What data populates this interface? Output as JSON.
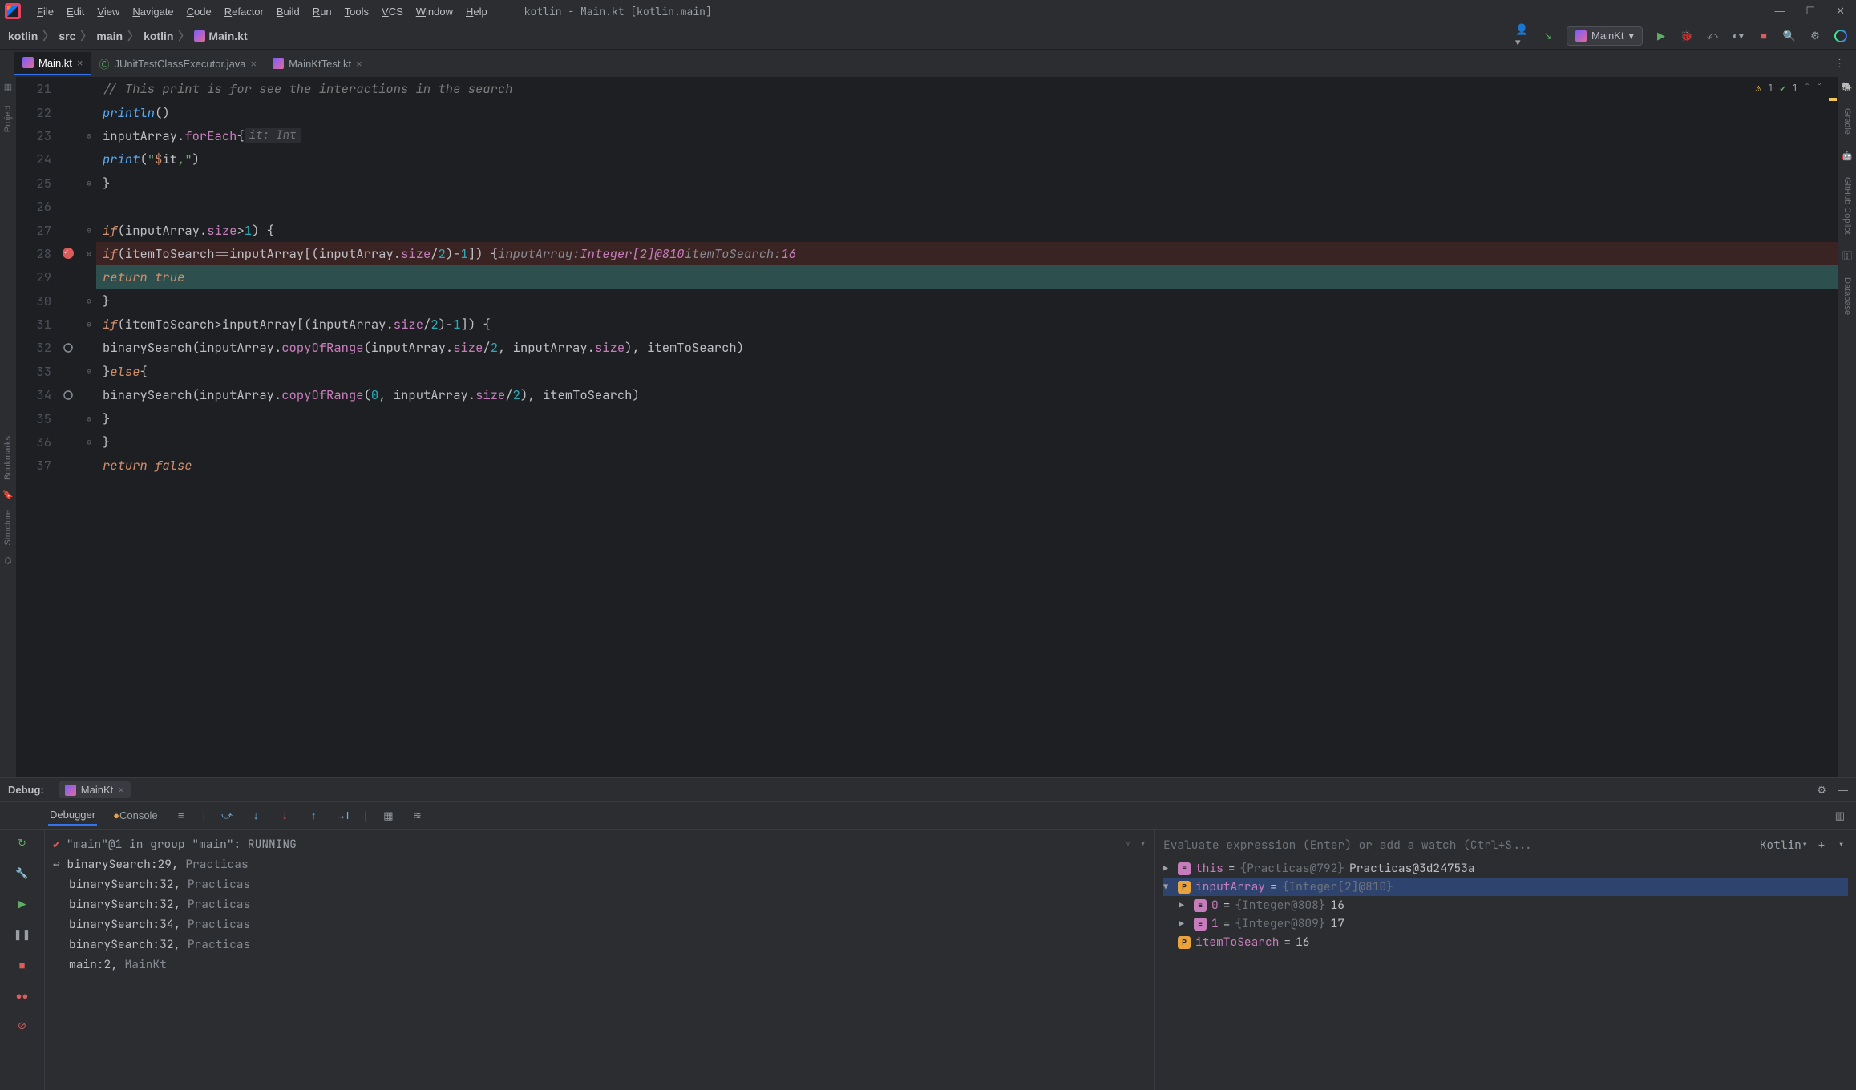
{
  "window": {
    "title": "kotlin - Main.kt [kotlin.main]"
  },
  "menu": [
    "File",
    "Edit",
    "View",
    "Navigate",
    "Code",
    "Refactor",
    "Build",
    "Run",
    "Tools",
    "VCS",
    "Window",
    "Help"
  ],
  "breadcrumb": [
    "kotlin",
    "src",
    "main",
    "kotlin",
    "Main.kt"
  ],
  "runConfig": "MainKt",
  "tabs": [
    {
      "label": "Main.kt",
      "active": true,
      "icon": "kotlin-file"
    },
    {
      "label": "JUnitTestClassExecutor.java",
      "active": false,
      "icon": "java-class"
    },
    {
      "label": "MainKtTest.kt",
      "active": false,
      "icon": "kotlin-class"
    }
  ],
  "inspections": {
    "warnings": "1",
    "passed": "1"
  },
  "editor": {
    "startLine": 21,
    "lines": [
      {
        "n": 21,
        "html": "        <span class='c-comment'>// This print is for see the interactions in the search</span>"
      },
      {
        "n": 22,
        "html": "        <span class='c-fn'>println</span><span class='c-brace'>()</span>"
      },
      {
        "n": 23,
        "html": "        <span class='c-id'>inputArray</span>.<span class='c-fn2'>forEach</span> <span class='c-brace'>{</span> <span class='c-hint'>it: Int</span>",
        "fold": "⊖"
      },
      {
        "n": 24,
        "html": "            <span class='c-fn'>print</span><span class='c-brace'>(</span><span class='c-str'>\"</span><span class='c-kw2'>$</span><span class='c-id'>it</span><span class='c-str'>,\"</span><span class='c-brace'>)</span>"
      },
      {
        "n": 25,
        "html": "        <span class='c-brace'>}</span>",
        "fold": "⊖"
      },
      {
        "n": 26,
        "html": ""
      },
      {
        "n": 27,
        "html": "        <span class='c-kw'>if</span> <span class='c-brace'>(</span><span class='c-id'>inputArray</span>.<span class='c-fn2'>size</span> <span class='c-op'>&gt;</span> <span class='c-num'>1</span><span class='c-brace'>) {</span>",
        "fold": "⊖"
      },
      {
        "n": 28,
        "bp": true,
        "hl": "bp",
        "html": "            <span class='c-kw'>if</span> <span class='c-brace'>(</span><span class='c-id'>itemToSearch</span> <span class='c-op'>==</span> <span class='c-id'>inputArray</span><span class='c-brace'>[(</span><span class='c-id'>inputArray</span>.<span class='c-fn2'>size</span> <span class='c-op'>/</span> <span class='c-num'>2</span><span class='c-brace'>)</span> <span class='c-op'>-</span> <span class='c-num'>1</span><span class='c-brace'>]) {</span>   <span class='c-inlay-var'>inputArray:</span> <span class='c-inlay-val'>Integer[2]@810</span>    <span class='c-inlay-var'>itemToSearch:</span> <span class='c-inlay-val'>16</span>",
        "fold": "⊖"
      },
      {
        "n": 29,
        "hl": "exec",
        "html": "                <span class='c-kw'>return true</span>"
      },
      {
        "n": 30,
        "html": "            <span class='c-brace'>}</span>",
        "fold": "⊖"
      },
      {
        "n": 31,
        "html": "            <span class='c-kw'>if</span> <span class='c-brace'>(</span><span class='c-id'>itemToSearch</span> <span class='c-op'>&gt;</span> <span class='c-id'>inputArray</span><span class='c-brace'>[(</span><span class='c-id'>inputArray</span>.<span class='c-fn2'>size</span> <span class='c-op'>/</span> <span class='c-num'>2</span><span class='c-brace'>)</span> <span class='c-op'>-</span> <span class='c-num'>1</span><span class='c-brace'>]) {</span>",
        "fold": "⊖"
      },
      {
        "n": 32,
        "cov": true,
        "html": "                <span class='c-id'>binarySearch</span><span class='c-brace'>(</span><span class='c-id'>inputArray</span>.<span class='c-fn2'>copyOfRange</span><span class='c-brace'>(</span><span class='c-id'>inputArray</span>.<span class='c-fn2'>size</span> <span class='c-op'>/</span> <span class='c-num'>2</span>, <span class='c-id'>inputArray</span>.<span class='c-fn2'>size</span><span class='c-brace'>)</span>, <span class='c-id'>itemToSearch</span><span class='c-brace'>)</span>"
      },
      {
        "n": 33,
        "html": "            <span class='c-brace'>}</span> <span class='c-kw'>else</span> <span class='c-brace'>{</span>",
        "fold": "⊖"
      },
      {
        "n": 34,
        "cov": true,
        "html": "                <span class='c-id'>binarySearch</span><span class='c-brace'>(</span><span class='c-id'>inputArray</span>.<span class='c-fn2'>copyOfRange</span><span class='c-brace'>(</span><span class='c-num'>0</span>, <span class='c-id'>inputArray</span>.<span class='c-fn2'>size</span> <span class='c-op'>/</span> <span class='c-num'>2</span><span class='c-brace'>)</span>, <span class='c-id'>itemToSearch</span><span class='c-brace'>)</span>"
      },
      {
        "n": 35,
        "html": "            <span class='c-brace'>}</span>",
        "fold": "⊖"
      },
      {
        "n": 36,
        "html": "        <span class='c-brace'>}</span>",
        "fold": "⊖"
      },
      {
        "n": 37,
        "html": "        <span class='c-kw'>return false</span>"
      }
    ]
  },
  "debug": {
    "label": "Debug:",
    "session": "MainKt",
    "tabs": {
      "debugger": "Debugger",
      "console": "Console"
    },
    "thread": "\"main\"@1 in group \"main\": RUNNING",
    "frames": [
      {
        "text": "binarySearch:29, Practicas",
        "top": true
      },
      {
        "text": "binarySearch:32, Practicas"
      },
      {
        "text": "binarySearch:32, Practicas"
      },
      {
        "text": "binarySearch:34, Practicas"
      },
      {
        "text": "binarySearch:32, Practicas"
      },
      {
        "text": "main:2, MainKt"
      }
    ],
    "evalPlaceholder": "Evaluate expression (Enter) or add a watch (Ctrl+S...",
    "evalLang": "Kotlin",
    "vars": [
      {
        "indent": 0,
        "arrow": "▶",
        "icon": "f",
        "name": "this",
        "eq": " = ",
        "grey": "{Practicas@792}",
        "plain": " Practicas@3d24753a"
      },
      {
        "indent": 0,
        "arrow": "▼",
        "icon": "p",
        "name": "inputArray",
        "eq": " = ",
        "grey": "{Integer[2]@810}",
        "sel": true
      },
      {
        "indent": 1,
        "arrow": "▶",
        "icon": "f",
        "name": "0",
        "eq": " = ",
        "grey": "{Integer@808}",
        "plain": " 16"
      },
      {
        "indent": 1,
        "arrow": "▶",
        "icon": "f",
        "name": "1",
        "eq": " = ",
        "grey": "{Integer@809}",
        "plain": " 17"
      },
      {
        "indent": 0,
        "arrow": "",
        "icon": "p",
        "name": "itemToSearch",
        "eq": " = ",
        "plain": "16"
      }
    ]
  },
  "leftTools": [
    "Project"
  ],
  "rightTools": [
    "Gradle",
    "GitHub Copilot",
    "Database"
  ],
  "farLeft": [
    "Bookmarks",
    "Structure"
  ]
}
